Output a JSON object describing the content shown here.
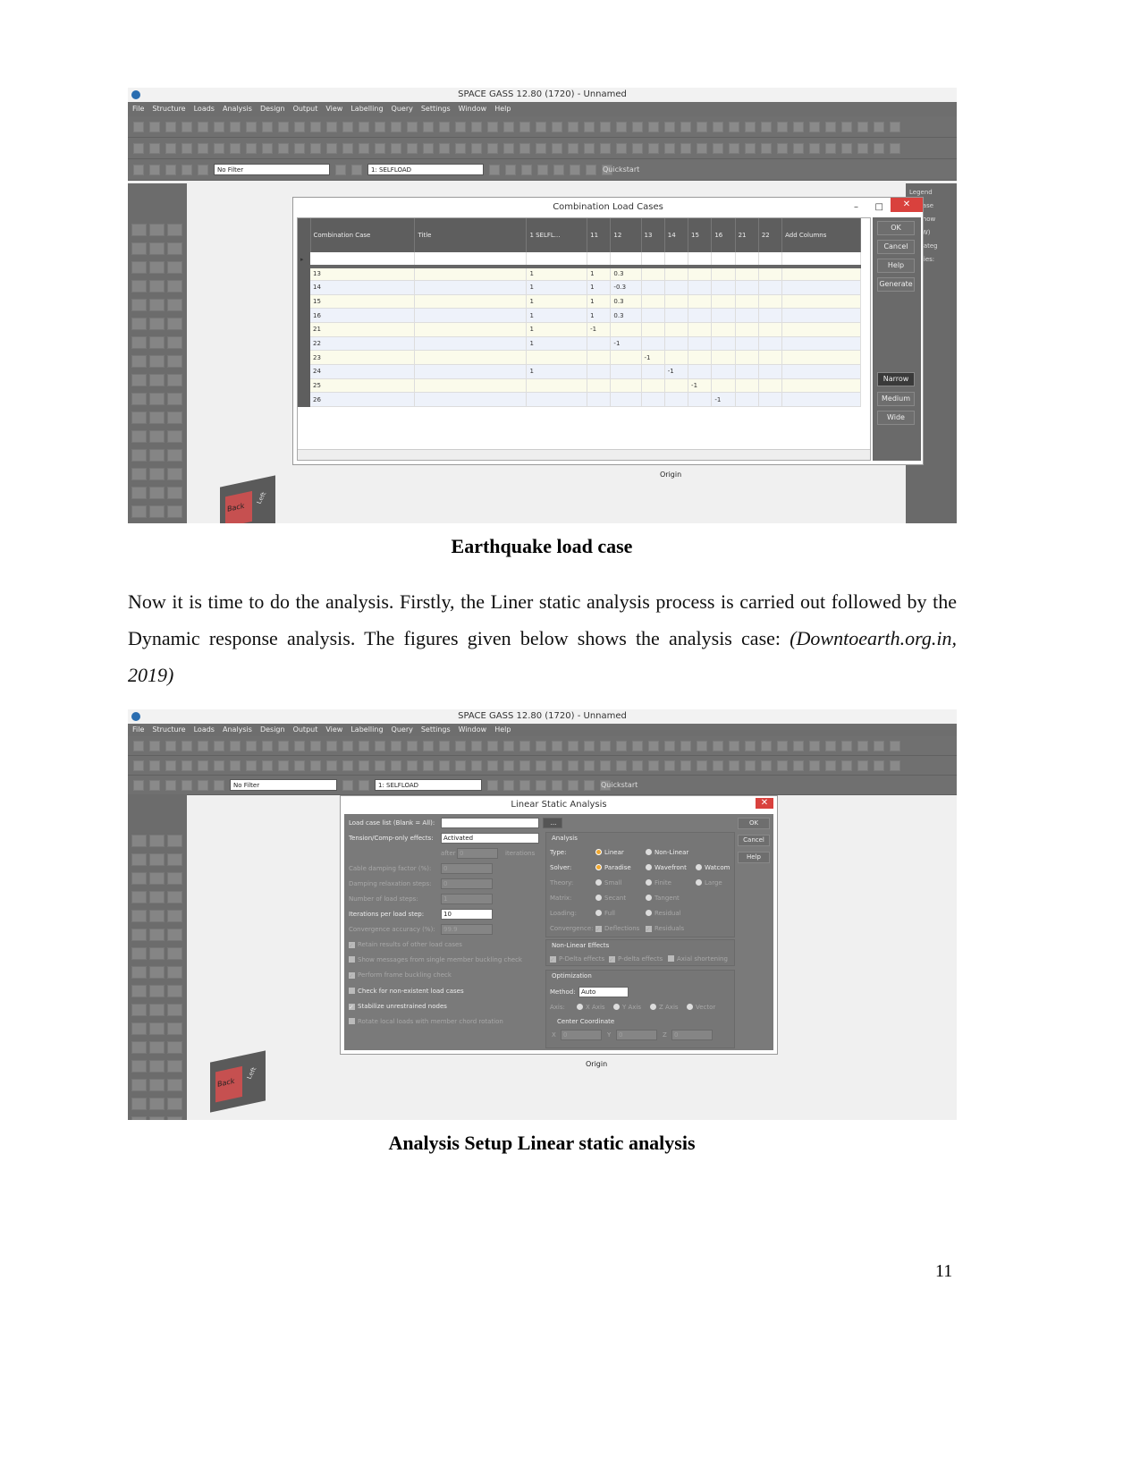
{
  "app": {
    "title": "SPACE GASS 12.80 (1720) - Unnamed",
    "menu": [
      "File",
      "Structure",
      "Loads",
      "Analysis",
      "Design",
      "Output",
      "View",
      "Labelling",
      "Query",
      "Settings",
      "Window",
      "Help"
    ],
    "filter": "No Filter",
    "loadcase": "1: SELFLOAD",
    "quickstart": "Quickstart",
    "origin": "Origin",
    "cube_back": "Back",
    "cube_left": "Left"
  },
  "fig1": {
    "dialog_title": "Combination Load Cases",
    "columns": [
      "Combination Case",
      "Title",
      "1 SELFL...",
      "11",
      "12",
      "13",
      "14",
      "15",
      "16",
      "21",
      "22",
      "Add Columns"
    ],
    "rows": [
      [
        "13",
        "",
        "1",
        "1",
        "0.3",
        "",
        "",
        "",
        "",
        "",
        ""
      ],
      [
        "14",
        "",
        "1",
        "1",
        "-0.3",
        "",
        "",
        "",
        "",
        "",
        ""
      ],
      [
        "15",
        "",
        "1",
        "1",
        "0.3",
        "",
        "",
        "",
        "",
        "",
        ""
      ],
      [
        "16",
        "",
        "1",
        "1",
        "0.3",
        "",
        "",
        "",
        "",
        "",
        ""
      ],
      [
        "21",
        "",
        "1",
        "-1",
        "",
        "",
        "",
        "",
        "",
        "",
        ""
      ],
      [
        "22",
        "",
        "1",
        "",
        "-1",
        "",
        "",
        "",
        "",
        "",
        ""
      ],
      [
        "23",
        "",
        "",
        "",
        "",
        "-1",
        "",
        "",
        "",
        "",
        ""
      ],
      [
        "24",
        "",
        "1",
        "",
        "",
        "",
        "-1",
        "",
        "",
        "",
        ""
      ],
      [
        "25",
        "",
        "",
        "",
        "",
        "",
        "",
        "-1",
        "",
        "",
        ""
      ],
      [
        "26",
        "",
        "",
        "",
        "",
        "",
        "",
        "",
        "-1",
        "",
        ""
      ]
    ],
    "buttons": [
      "OK",
      "Cancel",
      "Help",
      "Generate",
      "Narrow",
      "Medium",
      "Wide"
    ],
    "legend_panel": [
      "Legend",
      "ad case",
      "ds Show",
      "1 (SW)",
      "ad Categ",
      "egories:",
      "0"
    ],
    "caption": "Earthquake load case"
  },
  "paragraph": "Now it is time to do the analysis. Firstly, the Liner static analysis process is carried out followed by the Dynamic response analysis. The figures given below shows the analysis case: ",
  "paragraph_citation": "(Downtoearth.org.in, 2019)",
  "fig2": {
    "dialog_title": "Linear Static Analysis",
    "load_case_label": "Load case list (Blank = All):",
    "load_case_value": "",
    "browse": "...",
    "tension_label": "Tension/Comp-only effects:",
    "tension_value": "Activated",
    "after": "after",
    "after_value": "0",
    "iterations": "iterations",
    "fields": [
      {
        "label": "Cable damping factor (%):",
        "value": "0",
        "enabled": false
      },
      {
        "label": "Damping relaxation steps:",
        "value": "0",
        "enabled": false
      },
      {
        "label": "Number of load steps:",
        "value": "1",
        "enabled": false
      },
      {
        "label": "Iterations per load step:",
        "value": "10",
        "enabled": true
      },
      {
        "label": "Convergence accuracy (%):",
        "value": "99.9",
        "enabled": false
      }
    ],
    "checks": [
      {
        "label": "Retain results of other load cases",
        "checked": true,
        "enabled": false
      },
      {
        "label": "Show messages from single member buckling check",
        "checked": false,
        "enabled": false
      },
      {
        "label": "Perform frame buckling check",
        "checked": true,
        "enabled": false
      },
      {
        "label": "Check for non-existent load cases",
        "checked": false,
        "enabled": true
      },
      {
        "label": "Stabilize unrestrained nodes",
        "checked": true,
        "enabled": true
      },
      {
        "label": "Rotate local loads with member chord rotation",
        "checked": false,
        "enabled": false
      }
    ],
    "analysis_group": "Analysis",
    "options": [
      {
        "label": "Type:",
        "items": [
          "Linear",
          "Non-Linear"
        ],
        "selected": 0,
        "enabled": true
      },
      {
        "label": "Solver:",
        "items": [
          "Paradise",
          "Wavefront",
          "Watcom"
        ],
        "selected": 0,
        "enabled": true
      },
      {
        "label": "Theory:",
        "items": [
          "Small",
          "Finite",
          "Large"
        ],
        "enabled": false
      },
      {
        "label": "Matrix:",
        "items": [
          "Secant",
          "Tangent"
        ],
        "enabled": false
      },
      {
        "label": "Loading:",
        "items": [
          "Full",
          "Residual"
        ],
        "enabled": false
      }
    ],
    "convergence_label": "Convergence:",
    "convergence": [
      "Deflections",
      "Residuals"
    ],
    "nonlinear_group": "Non-Linear Effects",
    "nonlinear": [
      "P-Delta effects",
      "P-delta effects",
      "Axial shortening"
    ],
    "opt_group": "Optimization",
    "method_label": "Method:",
    "method_value": "Auto",
    "axis_label": "Axis:",
    "axes": [
      "X Axis",
      "Y Axis",
      "Z Axis",
      "Vector"
    ],
    "center_label": "Center Coordinate",
    "coords": [
      {
        "k": "X",
        "v": "0"
      },
      {
        "k": "Y",
        "v": "0"
      },
      {
        "k": "Z",
        "v": "0"
      }
    ],
    "buttons": [
      "OK",
      "Cancel",
      "Help"
    ],
    "caption": "Analysis Setup Linear static analysis"
  },
  "page_number": "11"
}
